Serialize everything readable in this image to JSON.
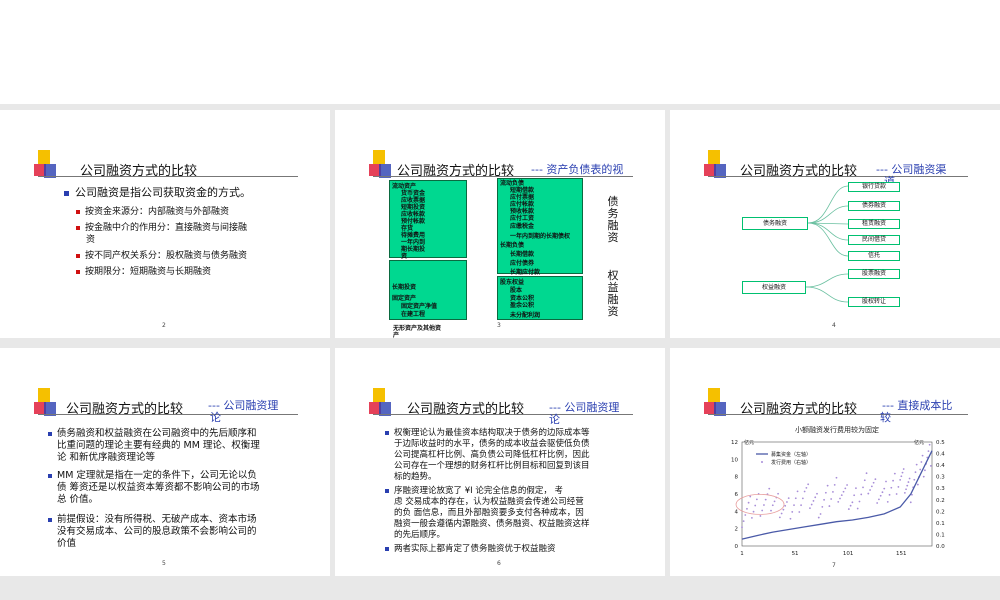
{
  "slides": {
    "s2": {
      "title": "公司融资方式的比较",
      "page": "2",
      "main": "公司融资是指公司获取资金的方式。",
      "items": [
        "按资金来源分：内部融资与外部融资",
        "按金融中介的作用分：直接融资与间接融",
        "资",
        "按不同产权关系分：股权融资与债务融资",
        "按期限分：短期融资与长期融资"
      ]
    },
    "s3": {
      "title": "公司融资方式的比较",
      "subtitle": "--- 资产负债表的视",
      "page": "3",
      "left_box1": [
        "流动资产",
        "货币资金",
        "应收票据",
        "短期投资",
        "应收帐款",
        "预付帐款",
        "存货",
        "待摊费用",
        "一年内到",
        "期长期投",
        "资"
      ],
      "left_box2": [
        "长期投资",
        "固定资产",
        "固定资产净值",
        "在建工程"
      ],
      "left_bottom": [
        "无形资产及其他资",
        "产"
      ],
      "right_box1": [
        "流动负债",
        "短期借款",
        "应付票据",
        "应付帐款",
        "预收帐款",
        "应付工资",
        "应缴税金",
        "一年内到期的长期债权",
        "长期负债",
        "长期借款",
        "应付债券",
        "长期应付款"
      ],
      "right_box2": [
        "股东权益",
        "股本",
        "资本公积",
        "盈余公积",
        "未分配利润"
      ],
      "debt_label": "债务融资",
      "equity_label": "权益融资"
    },
    "s4": {
      "title": "公司融资方式的比较",
      "subtitle": "--- 公司融资渠",
      "subtitle2": "道",
      "page": "4",
      "debt": "债务融资",
      "equity": "权益融资",
      "debt_items": [
        "银行贷款",
        "债券融资",
        "租赁融资",
        "民间借贷",
        "信托"
      ],
      "equity_items": [
        "股票融资",
        "股权转让"
      ]
    },
    "s5": {
      "title": "公司融资方式的比较",
      "subtitle": "--- 公司融资理",
      "subtitle2": "论",
      "page": "5",
      "items": [
        [
          "债务融资和权益融资在公司融资中的先后顺序和",
          "比重问题的理论主要有经典的 MM 理论、权衡理",
          "论 和新优序融资理论等"
        ],
        [
          "MM 定理就是指在一定的条件下，公司无论以负",
          "债 筹资还是以权益资本筹资都不影响公司的市场",
          "总 价值。"
        ],
        [
          "前提假设：没有所得税、无破产成本、资本市场",
          "没有交易成本、公司的股息政策不会影响公司的",
          "价值"
        ]
      ]
    },
    "s6": {
      "title": "公司融资方式的比较",
      "subtitle": "--- 公司融资理",
      "subtitle2": "论",
      "page": "6",
      "items": [
        [
          "权衡理论认为最佳资本结构取决于债务的边际成本等",
          "于边际收益时的水平，债务的成本收益会驱使低负债",
          "公司提高杠杆比例、高负债公司降低杠杆比例，因此",
          "公司存在一个理想的财务杠杆比例目标和回复到该目",
          "标的趋势。"
        ],
        [
          "序融资理论放宽了 ¥I 论完全信息的假定， 考",
          "虑 交易成本的存在，认为权益融资会传递公司经营",
          "的负 面信息，而且外部融资要多支付各种成本，因",
          "融资一般会遵循内源融资、债务融资、权益融资这样",
          "的先后顺序。"
        ],
        [
          "两者实际上都肯定了债务融资优于权益融资"
        ]
      ]
    },
    "s7": {
      "title": "公司融资方式的比较",
      "subtitle": "--- 直接成本比",
      "subtitle2": "较",
      "page": "7"
    }
  },
  "chart_data": {
    "type": "line",
    "title": "小额融资发行费用较为固定",
    "left_unit": "亿元",
    "right_unit": "亿元",
    "ylim_left": [
      0,
      12
    ],
    "ylim_right": [
      0,
      0.5
    ],
    "y_ticks_left": [
      "0",
      "2",
      "4",
      "6",
      "8",
      "10",
      "12"
    ],
    "y_ticks_right": [
      "0.0",
      "0.1",
      "0.1",
      "0.2",
      "0.2",
      "0.3",
      "0.3",
      "0.4",
      "0.4",
      "0.5"
    ],
    "x_ticks": [
      "1",
      "51",
      "101",
      "151"
    ],
    "xlim": [
      1,
      180
    ],
    "series": [
      {
        "name": "募集资金（左轴）",
        "color": "#4a5aa8",
        "values": [
          0.8,
          1.2,
          1.6,
          1.9,
          2.2,
          2.5,
          2.8,
          3.0,
          3.3,
          3.7,
          4.5,
          6.0,
          8.5,
          11.0
        ]
      },
      {
        "name": "发行费用（右轴）",
        "color": "#a88ed8",
        "values": [
          0.15,
          0.2,
          0.22,
          0.17,
          0.25,
          0.19,
          0.28,
          0.21,
          0.3,
          0.24,
          0.33,
          0.27,
          0.38,
          0.44
        ]
      }
    ],
    "x": [
      1,
      15,
      30,
      45,
      60,
      75,
      90,
      105,
      120,
      135,
      150,
      160,
      170,
      180
    ]
  }
}
